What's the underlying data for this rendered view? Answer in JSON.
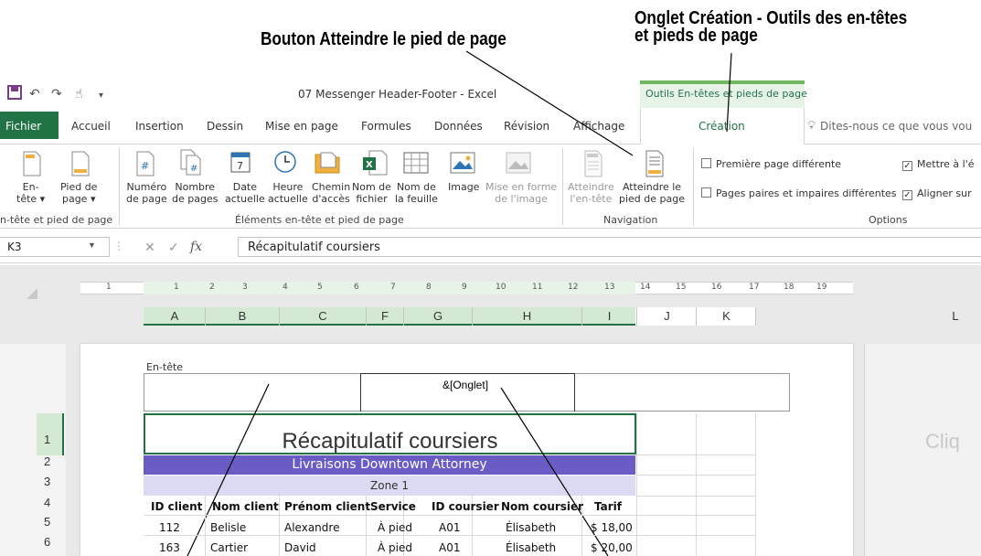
{
  "callouts": {
    "navigation_button": "Bouton Atteindre le pied de page",
    "design_tab_line1": "Onglet Création - Outils des en-têtes",
    "design_tab_line2": "et pieds de page"
  },
  "titlebar": {
    "title": "07 Messenger Header-Footer - Excel",
    "context_tab_title": "Outils En-têtes et pieds de page"
  },
  "tabs": {
    "file": "Fichier",
    "home": "Accueil",
    "insert": "Insertion",
    "draw": "Dessin",
    "layout": "Mise en page",
    "formulas": "Formules",
    "data": "Données",
    "review": "Révision",
    "view": "Affichage",
    "design": "Création",
    "tellme": "Dites-nous ce que vous vou"
  },
  "ribbon": {
    "header_l1": "En-",
    "header_l2": "tête ▾",
    "footer_l1": "Pied de",
    "footer_l2": "page ▾",
    "grp_headerfooter": "n-tête et pied de page",
    "pagenum_l1": "Numéro",
    "pagenum_l2": "de page",
    "pagecount_l1": "Nombre",
    "pagecount_l2": "de pages",
    "curdate_l1": "Date",
    "curdate_l2": "actuelle",
    "curtime_l1": "Heure",
    "curtime_l2": "actuelle",
    "filepath_l1": "Chemin",
    "filepath_l2": "d'accès",
    "filename_l1": "Nom de",
    "filename_l2": "fichier",
    "sheetname_l1": "Nom de",
    "sheetname_l2": "la feuille",
    "picture": "Image",
    "formatpic_l1": "Mise en forme",
    "formatpic_l2": "de l'image",
    "grp_elements": "Éléments en-tête et pied de page",
    "gotoheader_l1": "Atteindre",
    "gotoheader_l2": "l'en-tête",
    "gotofooter_l1": "Atteindre le",
    "gotofooter_l2": "pied de page",
    "grp_navigation": "Navigation",
    "opt_firstpage": "Première page différente",
    "opt_oddeven": "Pages paires et impaires différentes",
    "opt_scale": "Mettre à l'é",
    "opt_align": "Aligner sur",
    "grp_options": "Options",
    "check_mark": "✓"
  },
  "formula_bar": {
    "name_box": "K3",
    "cancel": "✕",
    "enter": "✓",
    "fx": "fx",
    "value": "Récapitulatif coursiers"
  },
  "ruler": [
    "1",
    "1",
    "2",
    "3",
    "4",
    "5",
    "6",
    "7",
    "8",
    "9",
    "10",
    "11",
    "12",
    "13",
    "14",
    "15",
    "16",
    "17",
    "18",
    "19"
  ],
  "columns": [
    "A",
    "B",
    "C",
    "F",
    "G",
    "H",
    "I",
    "J",
    "K",
    "L"
  ],
  "rows": [
    "1",
    "2",
    "3",
    "4",
    "5",
    "6"
  ],
  "sheet": {
    "header_label": "En-tête",
    "header_code": "&[Onglet]",
    "title": "Récapitulatif coursiers",
    "subtitle": "Livraisons Downtown Attorney",
    "zone": "Zone 1",
    "headers": [
      "ID client",
      "Nom client",
      "Prénom client",
      "Service",
      "ID coursier",
      "Nom coursier",
      "Tarif"
    ],
    "data_rows": [
      [
        "112",
        "Belisle",
        "Alexandre",
        "À pied",
        "A01",
        "Élisabeth",
        "$ 18,00"
      ],
      [
        "163",
        "Cartier",
        "David",
        "À pied",
        "A01",
        "Élisabeth",
        "$ 20,00"
      ]
    ],
    "next_page_text": "Cliq"
  },
  "colors": {
    "excel_green": "#217346",
    "band_purple": "#6b5cc5",
    "band_lavender": "#dcd9f2"
  }
}
